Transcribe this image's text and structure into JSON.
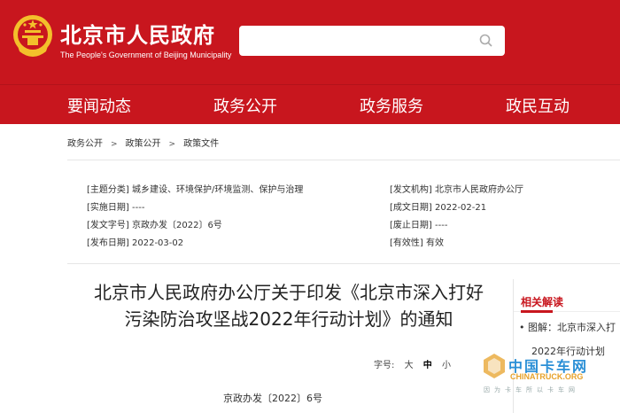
{
  "header": {
    "title": "北京市人民政府",
    "subtitle": "The People's Government of Beijing Municipality",
    "search_placeholder": ""
  },
  "nav": {
    "items": [
      "要闻动态",
      "政务公开",
      "政务服务",
      "政民互动"
    ]
  },
  "breadcrumb": [
    "政务公开",
    "政策公开",
    "政策文件"
  ],
  "meta": {
    "left": [
      {
        "label": "[主题分类]",
        "value": "城乡建设、环境保护/环境监测、保护与治理"
      },
      {
        "label": "[实施日期]",
        "value": "----"
      },
      {
        "label": "[发文字号]",
        "value": "京政办发〔2022〕6号"
      },
      {
        "label": "[发布日期]",
        "value": "2022-03-02"
      }
    ],
    "right": [
      {
        "label": "[发文机构]",
        "value": "北京市人民政府办公厅"
      },
      {
        "label": "[成文日期]",
        "value": "2022-02-21"
      },
      {
        "label": "[废止日期]",
        "value": "----"
      },
      {
        "label": "[有效性]",
        "value": "有效"
      }
    ]
  },
  "article": {
    "title_line1": "北京市人民政府办公厅关于印发《北京市深入打好",
    "title_line2": "污染防治攻坚战2022年行动计划》的通知",
    "font_size_label": "字号:",
    "font_sizes": [
      "大",
      "中",
      "小"
    ],
    "doc_number": "京政办发〔2022〕6号"
  },
  "related": {
    "heading": "相关解读",
    "item_line1": "图解：北京市深入打",
    "item_line2": "2022年行动计划"
  },
  "watermark": {
    "cn": "中国卡车网",
    "en": "CHINATRUCK.ORG",
    "sub": "因为卡车所以卡车网"
  },
  "colors": {
    "brand_red": "#c8161e",
    "watermark_blue": "#2b8fd6",
    "watermark_orange": "#e7a22a"
  }
}
